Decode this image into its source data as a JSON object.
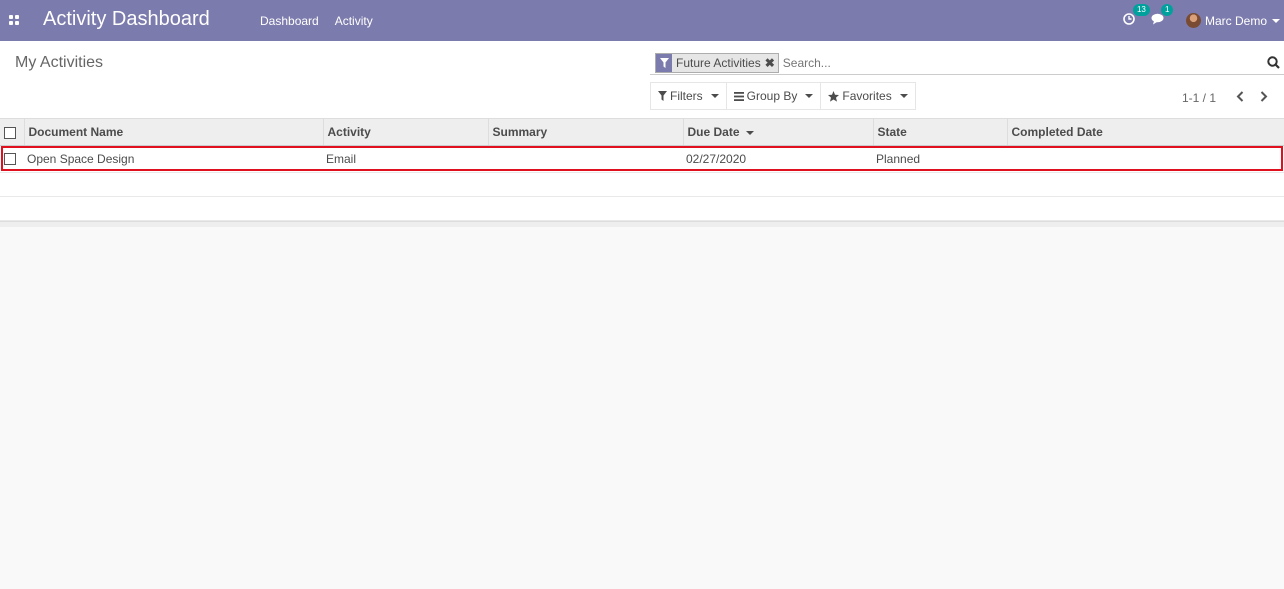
{
  "navbar": {
    "app_title": "Activity Dashboard",
    "menu": [
      {
        "label": "Dashboard"
      },
      {
        "label": "Activity"
      }
    ],
    "activities_badge": "13",
    "messages_badge": "1",
    "user_name": "Marc Demo"
  },
  "control_panel": {
    "breadcrumb": "My Activities",
    "facet_label": "Future Activities",
    "search_placeholder": "Search...",
    "filters_label": "Filters",
    "groupby_label": "Group By",
    "favorites_label": "Favorites",
    "pager_value": "1-1 / 1"
  },
  "table": {
    "columns": [
      "Document Name",
      "Activity",
      "Summary",
      "Due Date",
      "State",
      "Completed Date"
    ],
    "rows": [
      {
        "document_name": "Open Space Design",
        "activity": "Email",
        "summary": "",
        "due_date": "02/27/2020",
        "state": "Planned",
        "completed_date": ""
      }
    ]
  },
  "colors": {
    "navbar": "#7c7bad",
    "highlight": "#e0101f",
    "badge": "#00a09d"
  }
}
